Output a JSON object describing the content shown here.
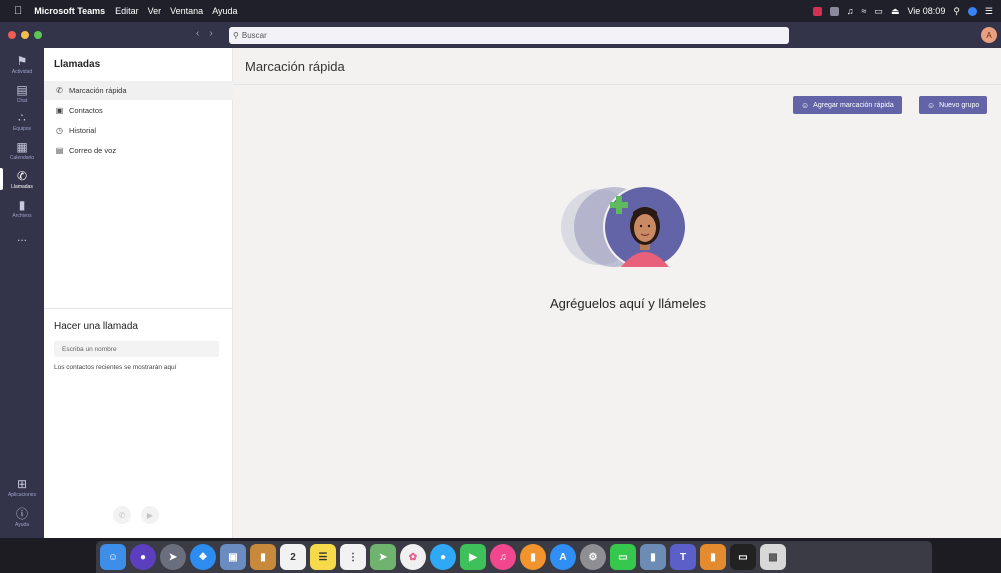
{
  "menubar": {
    "app_name": "Microsoft Teams",
    "items": [
      "Editar",
      "Ver",
      "Ventana",
      "Ayuda"
    ],
    "clock": "Vie 08:09"
  },
  "titlebar": {
    "search_placeholder": "Buscar",
    "avatar_initial": "A"
  },
  "rail": {
    "items": [
      {
        "label": "Actividad",
        "icon": "bell-icon"
      },
      {
        "label": "Chat",
        "icon": "chat-icon"
      },
      {
        "label": "Equipos",
        "icon": "teams-icon"
      },
      {
        "label": "Calendario",
        "icon": "calendar-icon"
      },
      {
        "label": "Llamadas",
        "icon": "phone-icon"
      },
      {
        "label": "Archivos",
        "icon": "files-icon"
      }
    ],
    "more": "...",
    "bottom": [
      {
        "label": "Aplicaciones",
        "icon": "apps-icon"
      },
      {
        "label": "Ayuda",
        "icon": "help-icon"
      }
    ]
  },
  "left_panel": {
    "title": "Llamadas",
    "nav": [
      {
        "label": "Marcación rápida",
        "icon": "phone-icon",
        "selected": true
      },
      {
        "label": "Contactos",
        "icon": "contacts-icon",
        "selected": false
      },
      {
        "label": "Historial",
        "icon": "history-icon",
        "selected": false
      },
      {
        "label": "Correo de voz",
        "icon": "voicemail-icon",
        "selected": false
      }
    ],
    "make_call_title": "Hacer una llamada",
    "name_placeholder": "Escriba un nombre",
    "recent_text": "Los contactos recientes se mostrarán aquí"
  },
  "main": {
    "title": "Marcación rápida",
    "add_speed_dial": "Agregar marcación rápida",
    "new_group": "Nuevo grupo",
    "empty_title": "Agréguelos aquí y llámeles"
  },
  "colors": {
    "rail_bg": "#33344a",
    "accent": "#6264a7",
    "menubar_bg": "#1f2029"
  }
}
